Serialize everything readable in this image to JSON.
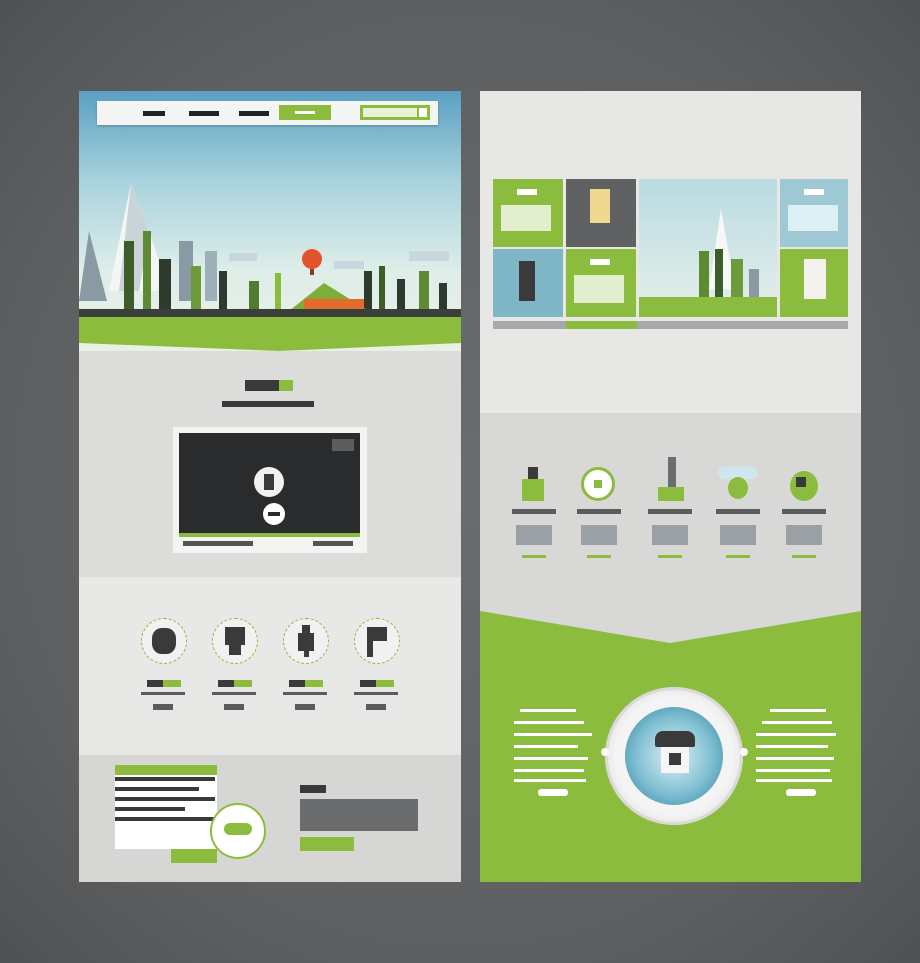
{
  "colors": {
    "background": "#5f6163",
    "accent_green": "#8cbc3d",
    "panel_light": "#e6e6e4",
    "panel_mid": "#d9d9d7",
    "dark": "#2f3032",
    "teal": "#3f8ea6"
  },
  "left_page": {
    "nav": {
      "cta_label": "",
      "link_count": 3
    },
    "hero": {
      "scene": "pixel-landscape"
    },
    "title_block": {
      "heading": ""
    },
    "video": {
      "caption": "",
      "play_icon": "play-icon",
      "marker_icon": "map-pin-icon"
    },
    "features": {
      "items": [
        {
          "icon": "gear-head-icon"
        },
        {
          "icon": "person-icon"
        },
        {
          "icon": "figure-icon"
        },
        {
          "icon": "flag-icon"
        }
      ]
    },
    "footer": {
      "button_label": "",
      "badge_icon": "cloud-icon"
    }
  },
  "right_page": {
    "gallery": {
      "tiles": [
        {
          "color": "#8cbc3d"
        },
        {
          "color": "#5f6163"
        },
        {
          "color": "#7fb6c6"
        },
        {
          "color": "#8cbc3d"
        },
        {
          "color": "#8cbc3d"
        },
        {
          "color": "#9ec8d3"
        }
      ],
      "active_slide": 2,
      "slide_count": 5
    },
    "services": {
      "items": [
        {
          "icon": "bottle-icon"
        },
        {
          "icon": "plate-icon"
        },
        {
          "icon": "microscope-icon"
        },
        {
          "icon": "flower-icon"
        },
        {
          "icon": "ball-icon"
        }
      ]
    },
    "contact": {
      "center_icon": "telephone-icon"
    }
  }
}
